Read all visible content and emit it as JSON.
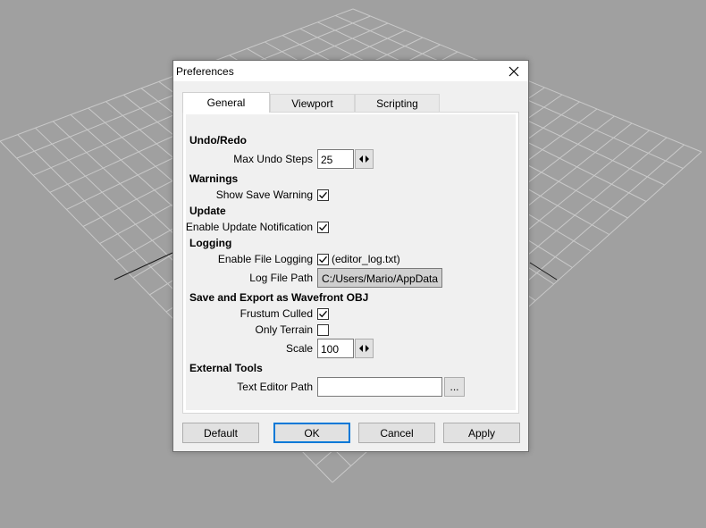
{
  "dialog": {
    "title": "Preferences"
  },
  "tabs": [
    {
      "label": "General",
      "active": true
    },
    {
      "label": "Viewport",
      "active": false
    },
    {
      "label": "Scripting",
      "active": false
    }
  ],
  "sections": {
    "undo_redo": {
      "title": "Undo/Redo",
      "max_undo_label": "Max Undo Steps",
      "max_undo_value": "25"
    },
    "warnings": {
      "title": "Warnings",
      "show_save_label": "Show Save Warning",
      "show_save_checked": true
    },
    "update": {
      "title": "Update",
      "enable_update_label": "Enable Update Notification",
      "enable_update_checked": true
    },
    "logging": {
      "title": "Logging",
      "enable_file_label": "Enable File Logging",
      "enable_file_checked": true,
      "enable_file_suffix": "(editor_log.txt)",
      "log_path_label": "Log File Path",
      "log_path_value": "C:/Users/Mario/AppData"
    },
    "export_obj": {
      "title": "Save and Export as Wavefront OBJ",
      "frustum_label": "Frustum Culled",
      "frustum_checked": true,
      "only_terrain_label": "Only Terrain",
      "only_terrain_checked": false,
      "scale_label": "Scale",
      "scale_value": "100"
    },
    "external_tools": {
      "title": "External Tools",
      "text_editor_label": "Text Editor Path",
      "text_editor_value": "",
      "browse_label": "..."
    }
  },
  "buttons": {
    "default": "Default",
    "ok": "OK",
    "cancel": "Cancel",
    "apply": "Apply"
  },
  "icons": {
    "close": "close-icon",
    "spin": "left-right-arrows-icon",
    "check": "checkmark-icon"
  },
  "colors": {
    "background": "#a0a0a0",
    "grid": "#c8c8c8",
    "dialog": "#f0f0f0",
    "focus_border": "#0078d7"
  }
}
